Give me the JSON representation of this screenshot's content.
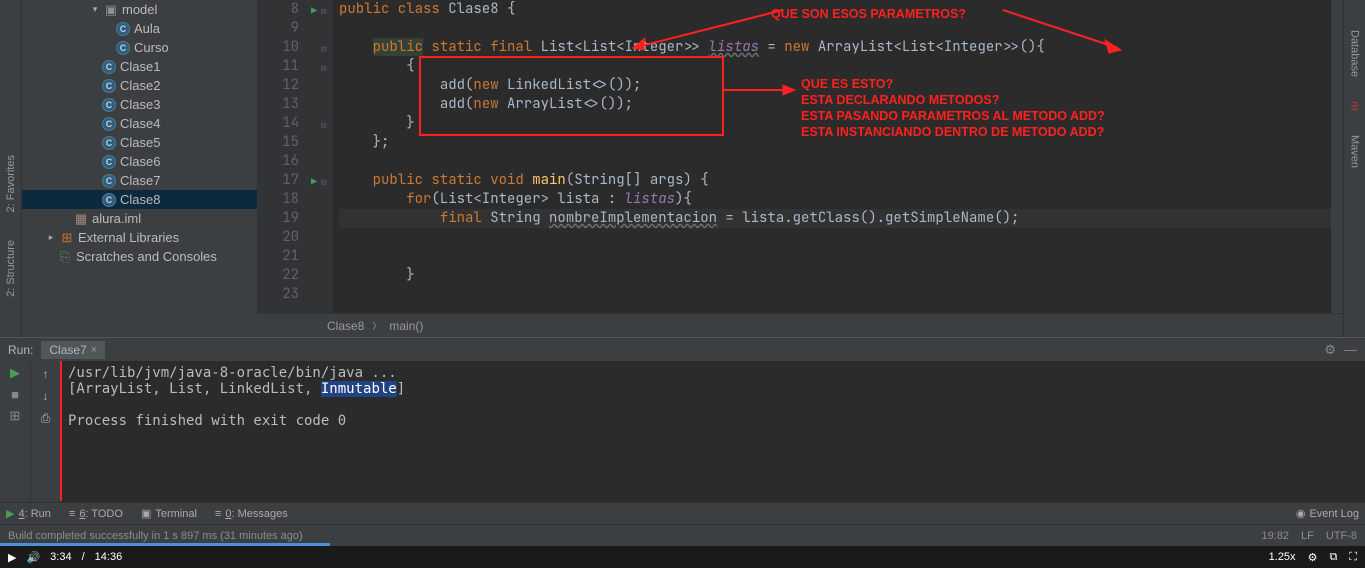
{
  "tree": {
    "model": "model",
    "aula": "Aula",
    "curso": "Curso",
    "clase1": "Clase1",
    "clase2": "Clase2",
    "clase3": "Clase3",
    "clase4": "Clase4",
    "clase5": "Clase5",
    "clase6": "Clase6",
    "clase7": "Clase7",
    "clase8": "Clase8",
    "alura": "alura.iml",
    "ext_lib": "External Libraries",
    "scratches": "Scratches and Consoles"
  },
  "gutter": [
    "8",
    "9",
    "10",
    "11",
    "12",
    "13",
    "14",
    "15",
    "16",
    "17",
    "18",
    "19",
    "20",
    "21",
    "22",
    "23"
  ],
  "code": {
    "l8_kw": "public class ",
    "l8_cls": "Clase8 ",
    "l8_br": "{",
    "l10_pub": "public",
    "l10_sf": " static final ",
    "l10_type": "List<List<Integer>> ",
    "l10_var": "listas",
    "l10_eq": " = ",
    "l10_new": "new ",
    "l10_al": "ArrayList<List<Integer>>(){",
    "l11": "{",
    "l12_add": "add(",
    "l12_new": "new ",
    "l12_ll": "LinkedList<>());",
    "l13_add": "add(",
    "l13_new": "new ",
    "l13_al": "ArrayList<>());",
    "l14": "}",
    "l15": "};",
    "l17_psv": "public static void ",
    "l17_main": "main",
    "l17_args": "(String[] args) {",
    "l18_for": "for",
    "l18_p": "(List<Integer> lista : ",
    "l18_var": "listas",
    "l18_end": "){",
    "l19_final": "final ",
    "l19_str": "String ",
    "l19_var": "nombreImplementacion",
    "l19_rest": " = lista.getClass().getSimpleName();",
    "l22": "}"
  },
  "annotations": {
    "a1": "QUE SON ESOS PARAMETROS?",
    "a2_l1": "QUE ES ESTO?",
    "a2_l2": "ESTA DECLARANDO METODOS?",
    "a2_l3": "ESTA PASANDO PARAMETROS AL METODO ADD?",
    "a2_l4": "ESTA INSTANCIANDO DENTRO DE METODO ADD?"
  },
  "breadcrumb": {
    "cls": "Clase8",
    "main": "main()"
  },
  "run": {
    "title": "Run:",
    "tab": "Clase7",
    "out1": "/usr/lib/jvm/java-8-oracle/bin/java ...",
    "out2_a": "[ArrayList, List, LinkedList, ",
    "out2_sel": "Inmutable",
    "out2_b": "]",
    "out3": "Process finished with exit code 0"
  },
  "bottom": {
    "run": "4: Run",
    "todo": "6: TODO",
    "term": "Terminal",
    "msg": "0: Messages",
    "event": "Event Log"
  },
  "status": {
    "build": "Build completed successfully in 1 s 897 ms (31 minutes ago)",
    "pos": "19:82",
    "lf": "LF",
    "enc": "UTF-8"
  },
  "rails": {
    "structure": "2: Structure",
    "favorites": "2: Favorites",
    "database": "Database",
    "maven": "Maven",
    "m": "m"
  },
  "video": {
    "cur": "3:34",
    "total": "14:36",
    "speed": "1.25x"
  }
}
